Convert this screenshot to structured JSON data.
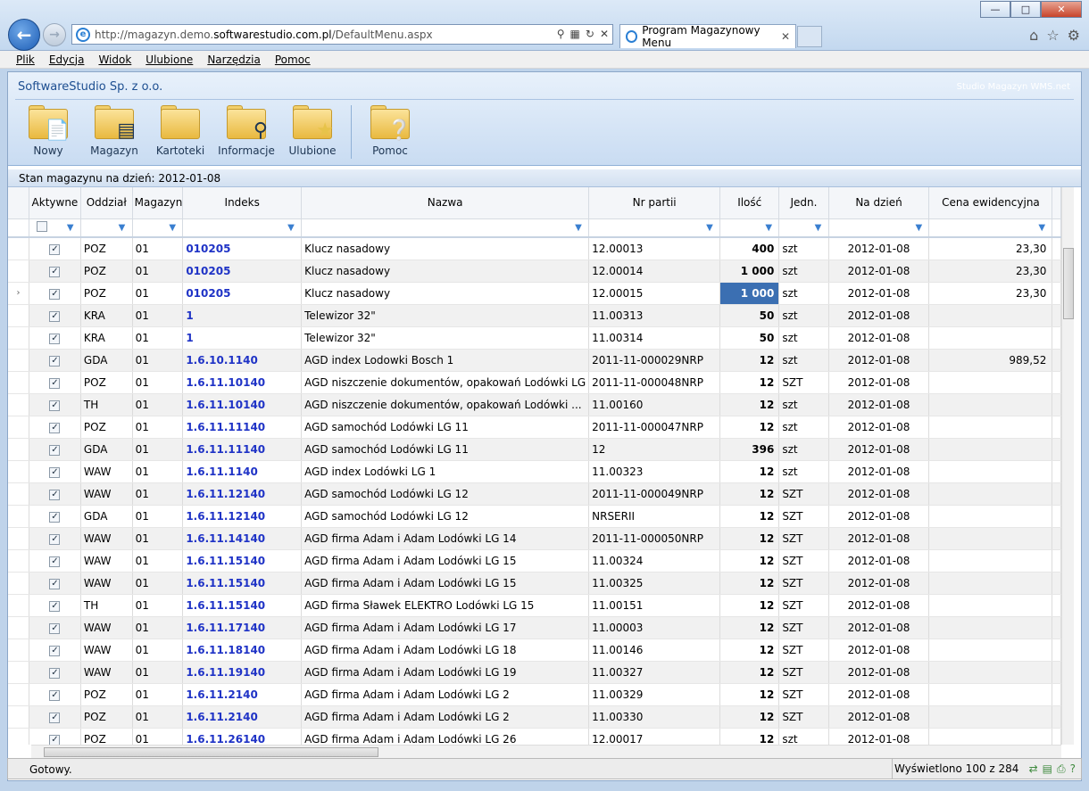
{
  "browser": {
    "url_prefix": "http://magazyn.demo.",
    "url_domain": "softwarestudio.com.pl",
    "url_path": "/DefaultMenu.aspx",
    "tab_title": "Program Magazynowy Menu",
    "window_buttons": {
      "min": "—",
      "max": "□",
      "close": "✕"
    }
  },
  "menu": [
    "Plik",
    "Edycja",
    "Widok",
    "Ulubione",
    "Narzędzia",
    "Pomoc"
  ],
  "app": {
    "company": "SoftwareStudio Sp. z o.o.",
    "product": "Studio Magazyn WMS.net",
    "toolbar": [
      {
        "label": "Nowy",
        "icon": "document-icon"
      },
      {
        "label": "Magazyn",
        "icon": "database-icon"
      },
      {
        "label": "Kartoteki",
        "icon": "folder-icon"
      },
      {
        "label": "Informacje",
        "icon": "magnifier-icon"
      },
      {
        "label": "Ulubione",
        "icon": "star-icon"
      },
      {
        "label": "Pomoc",
        "icon": "help-icon"
      }
    ]
  },
  "grid": {
    "title": "Stan magazynu na dzień: 2012-01-08",
    "columns": [
      "Aktywne",
      "Oddział",
      "Magazyn",
      "Indeks",
      "Nazwa",
      "Nr partii",
      "Ilość",
      "Jedn.",
      "Na dzień",
      "Cena ewidencyjna"
    ],
    "rows": [
      {
        "active": true,
        "branch": "POZ",
        "wh": "01",
        "index": "010205",
        "name": "Klucz nasadowy",
        "lot": "12.00013",
        "qty": "400",
        "unit": "szt",
        "date": "2012-01-08",
        "price": "23,30"
      },
      {
        "active": true,
        "branch": "POZ",
        "wh": "01",
        "index": "010205",
        "name": "Klucz nasadowy",
        "lot": "12.00014",
        "qty": "1 000",
        "unit": "szt",
        "date": "2012-01-08",
        "price": "23,30"
      },
      {
        "active": true,
        "branch": "POZ",
        "wh": "01",
        "index": "010205",
        "name": "Klucz nasadowy",
        "lot": "12.00015",
        "qty": "1 000",
        "unit": "szt",
        "date": "2012-01-08",
        "price": "23,30",
        "current": true
      },
      {
        "active": true,
        "branch": "KRA",
        "wh": "01",
        "index": "1",
        "name": "Telewizor 32\"",
        "lot": "11.00313",
        "qty": "50",
        "unit": "szt",
        "date": "2012-01-08",
        "price": ""
      },
      {
        "active": true,
        "branch": "KRA",
        "wh": "01",
        "index": "1",
        "name": "Telewizor 32\"",
        "lot": "11.00314",
        "qty": "50",
        "unit": "szt",
        "date": "2012-01-08",
        "price": ""
      },
      {
        "active": true,
        "branch": "GDA",
        "wh": "01",
        "index": "1.6.10.1140",
        "name": "AGD index Lodowki Bosch 1",
        "lot": "2011-11-000029NRP",
        "qty": "12",
        "unit": "szt",
        "date": "2012-01-08",
        "price": "989,52"
      },
      {
        "active": true,
        "branch": "POZ",
        "wh": "01",
        "index": "1.6.11.10140",
        "name": "AGD niszczenie dokumentów, opakowań Lodówki LG",
        "lot": "2011-11-000048NRP",
        "qty": "12",
        "unit": "SZT",
        "date": "2012-01-08",
        "price": ""
      },
      {
        "active": true,
        "branch": "TH",
        "wh": "01",
        "index": "1.6.11.10140",
        "name": "AGD niszczenie dokumentów, opakowań Lodówki ...",
        "lot": "11.00160",
        "qty": "12",
        "unit": "szt",
        "date": "2012-01-08",
        "price": ""
      },
      {
        "active": true,
        "branch": "POZ",
        "wh": "01",
        "index": "1.6.11.11140",
        "name": "AGD samochód Lodówki LG 11",
        "lot": "2011-11-000047NRP",
        "qty": "12",
        "unit": "szt",
        "date": "2012-01-08",
        "price": ""
      },
      {
        "active": true,
        "branch": "GDA",
        "wh": "01",
        "index": "1.6.11.11140",
        "name": "AGD samochód Lodówki LG 11",
        "lot": "12",
        "qty": "396",
        "unit": "szt",
        "date": "2012-01-08",
        "price": ""
      },
      {
        "active": true,
        "branch": "WAW",
        "wh": "01",
        "index": "1.6.11.1140",
        "name": "AGD index Lodówki LG 1",
        "lot": "11.00323",
        "qty": "12",
        "unit": "szt",
        "date": "2012-01-08",
        "price": ""
      },
      {
        "active": true,
        "branch": "WAW",
        "wh": "01",
        "index": "1.6.11.12140",
        "name": "AGD samochód Lodówki LG 12",
        "lot": "2011-11-000049NRP",
        "qty": "12",
        "unit": "SZT",
        "date": "2012-01-08",
        "price": ""
      },
      {
        "active": true,
        "branch": "GDA",
        "wh": "01",
        "index": "1.6.11.12140",
        "name": "AGD samochód Lodówki LG 12",
        "lot": "NRSERII",
        "qty": "12",
        "unit": "SZT",
        "date": "2012-01-08",
        "price": ""
      },
      {
        "active": true,
        "branch": "WAW",
        "wh": "01",
        "index": "1.6.11.14140",
        "name": "AGD firma Adam i Adam Lodówki LG 14",
        "lot": "2011-11-000050NRP",
        "qty": "12",
        "unit": "SZT",
        "date": "2012-01-08",
        "price": ""
      },
      {
        "active": true,
        "branch": "WAW",
        "wh": "01",
        "index": "1.6.11.15140",
        "name": "AGD firma Adam i Adam Lodówki LG 15",
        "lot": "11.00324",
        "qty": "12",
        "unit": "SZT",
        "date": "2012-01-08",
        "price": ""
      },
      {
        "active": true,
        "branch": "WAW",
        "wh": "01",
        "index": "1.6.11.15140",
        "name": "AGD firma Adam i Adam Lodówki LG 15",
        "lot": "11.00325",
        "qty": "12",
        "unit": "SZT",
        "date": "2012-01-08",
        "price": ""
      },
      {
        "active": true,
        "branch": "TH",
        "wh": "01",
        "index": "1.6.11.15140",
        "name": "AGD firma Sławek ELEKTRO Lodówki LG 15",
        "lot": "11.00151",
        "qty": "12",
        "unit": "SZT",
        "date": "2012-01-08",
        "price": ""
      },
      {
        "active": true,
        "branch": "WAW",
        "wh": "01",
        "index": "1.6.11.17140",
        "name": "AGD firma Adam i Adam Lodówki LG 17",
        "lot": "11.00003",
        "qty": "12",
        "unit": "SZT",
        "date": "2012-01-08",
        "price": ""
      },
      {
        "active": true,
        "branch": "WAW",
        "wh": "01",
        "index": "1.6.11.18140",
        "name": "AGD firma Adam i Adam Lodówki LG 18",
        "lot": "11.00146",
        "qty": "12",
        "unit": "SZT",
        "date": "2012-01-08",
        "price": ""
      },
      {
        "active": true,
        "branch": "WAW",
        "wh": "01",
        "index": "1.6.11.19140",
        "name": "AGD firma Adam i Adam Lodówki LG 19",
        "lot": "11.00327",
        "qty": "12",
        "unit": "SZT",
        "date": "2012-01-08",
        "price": ""
      },
      {
        "active": true,
        "branch": "POZ",
        "wh": "01",
        "index": "1.6.11.2140",
        "name": "AGD firma Adam i Adam Lodówki LG 2",
        "lot": "11.00329",
        "qty": "12",
        "unit": "SZT",
        "date": "2012-01-08",
        "price": ""
      },
      {
        "active": true,
        "branch": "POZ",
        "wh": "01",
        "index": "1.6.11.2140",
        "name": "AGD firma Adam i Adam Lodówki LG 2",
        "lot": "11.00330",
        "qty": "12",
        "unit": "SZT",
        "date": "2012-01-08",
        "price": ""
      },
      {
        "active": true,
        "branch": "POZ",
        "wh": "01",
        "index": "1.6.11.26140",
        "name": "AGD firma Adam i Adam Lodówki LG 26",
        "lot": "12.00017",
        "qty": "12",
        "unit": "szt",
        "date": "2012-01-08",
        "price": ""
      }
    ]
  },
  "status": {
    "left": "Gotowy.",
    "right": "Wyświetlono 100 z 284"
  }
}
